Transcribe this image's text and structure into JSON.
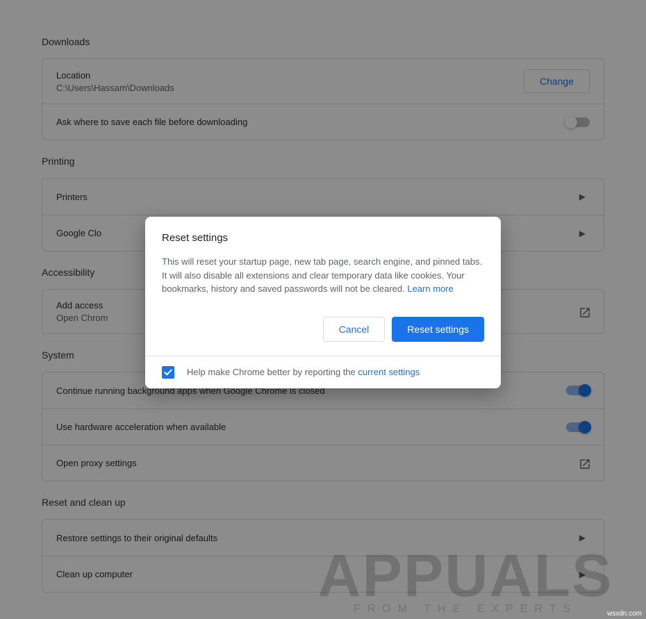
{
  "downloads": {
    "title": "Downloads",
    "location_label": "Location",
    "location_value": "C:\\Users\\Hassam\\Downloads",
    "change_label": "Change",
    "ask_label": "Ask where to save each file before downloading",
    "ask_enabled": false
  },
  "printing": {
    "title": "Printing",
    "printers": "Printers",
    "cloud_truncated": "Google Clo"
  },
  "accessibility": {
    "title": "Accessibility",
    "add_truncated": "Add access",
    "open_truncated": "Open Chrom"
  },
  "system": {
    "title": "System",
    "bg_apps": "Continue running background apps when Google Chrome is closed",
    "bg_enabled": true,
    "hw_accel": "Use hardware acceleration when available",
    "hw_enabled": true,
    "proxy": "Open proxy settings"
  },
  "reset_clean": {
    "title": "Reset and clean up",
    "restore": "Restore settings to their original defaults",
    "cleanup": "Clean up computer"
  },
  "dialog": {
    "title": "Reset settings",
    "body": "This will reset your startup page, new tab page, search engine, and pinned tabs. It will also disable all extensions and clear temporary data like cookies. Your bookmarks, history and saved passwords will not be cleared. ",
    "learn_more": "Learn more",
    "cancel": "Cancel",
    "confirm": "Reset settings",
    "help_prefix": "Help make Chrome better by reporting the ",
    "help_link": "current settings",
    "help_checked": true
  },
  "watermark": {
    "brand": "APPUALS",
    "tagline": "FROM THE EXPERTS",
    "attribution": "wsxdn.com"
  }
}
